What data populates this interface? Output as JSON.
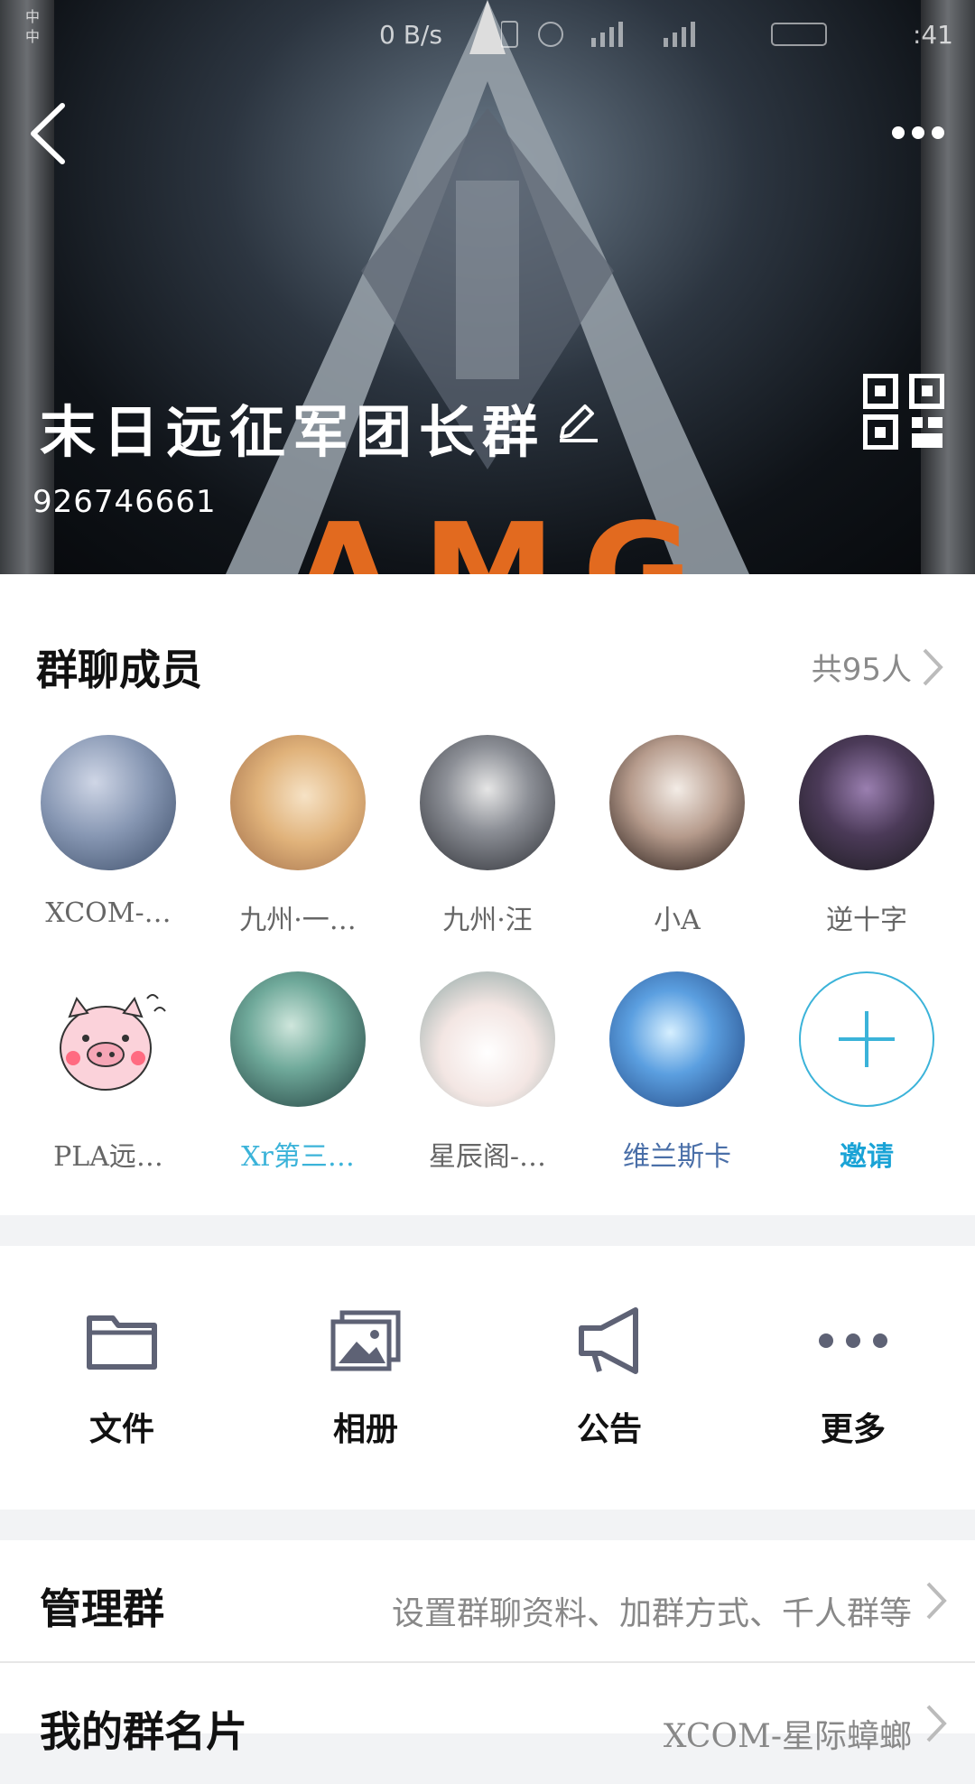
{
  "status_bar": {
    "carrier_lines": [
      "中",
      "中"
    ],
    "speed": "0 B/s",
    "time": ":41"
  },
  "header": {
    "group_name": "末日远征军团长群",
    "group_id": "926746661",
    "cover_text": "AMG"
  },
  "members": {
    "title": "群聊成员",
    "count": "共95人",
    "items": [
      {
        "name": "XCOM-…",
        "style": "gray",
        "colors": [
          "#cfd6e6",
          "#3a4b66"
        ]
      },
      {
        "name": "九州·一…",
        "style": "gray",
        "colors": [
          "#f3d2a0",
          "#9d6a47"
        ]
      },
      {
        "name": "九州·汪",
        "style": "gray",
        "colors": [
          "#d8d8d8",
          "#2d2f35"
        ]
      },
      {
        "name": "小A",
        "style": "gray",
        "colors": [
          "#efe9e4",
          "#3a2d28"
        ]
      },
      {
        "name": "逆十字",
        "style": "gray",
        "colors": [
          "#7d5a91",
          "#1a1a1d"
        ]
      },
      {
        "name": "PLA远…",
        "style": "gray",
        "colors": [
          "#ffffff",
          "#f7b7c3"
        ]
      },
      {
        "name": "Xr第三…",
        "style": "blue",
        "colors": [
          "#86c9b8",
          "#1e3a3a"
        ]
      },
      {
        "name": "星辰阁-…",
        "style": "gray",
        "colors": [
          "#ffffff",
          "#88a2a0"
        ]
      },
      {
        "name": "维兰斯卡",
        "style": "dkblue",
        "colors": [
          "#9fd3ff",
          "#1d3f7a"
        ]
      }
    ],
    "invite_label": "邀请"
  },
  "tools": [
    {
      "label": "文件",
      "icon": "folder-icon"
    },
    {
      "label": "相册",
      "icon": "album-icon"
    },
    {
      "label": "公告",
      "icon": "megaphone-icon"
    },
    {
      "label": "更多",
      "icon": "more-dots-icon"
    }
  ],
  "list": [
    {
      "key": "管理群",
      "value": "设置群聊资料、加群方式、千人群等"
    },
    {
      "key": "我的群名片",
      "value": "XCOM-星际蟑螂"
    }
  ],
  "colors": {
    "accent": "#3bb3d9",
    "icon_gray": "#5e6275",
    "amg_orange": "#e26a1f"
  }
}
